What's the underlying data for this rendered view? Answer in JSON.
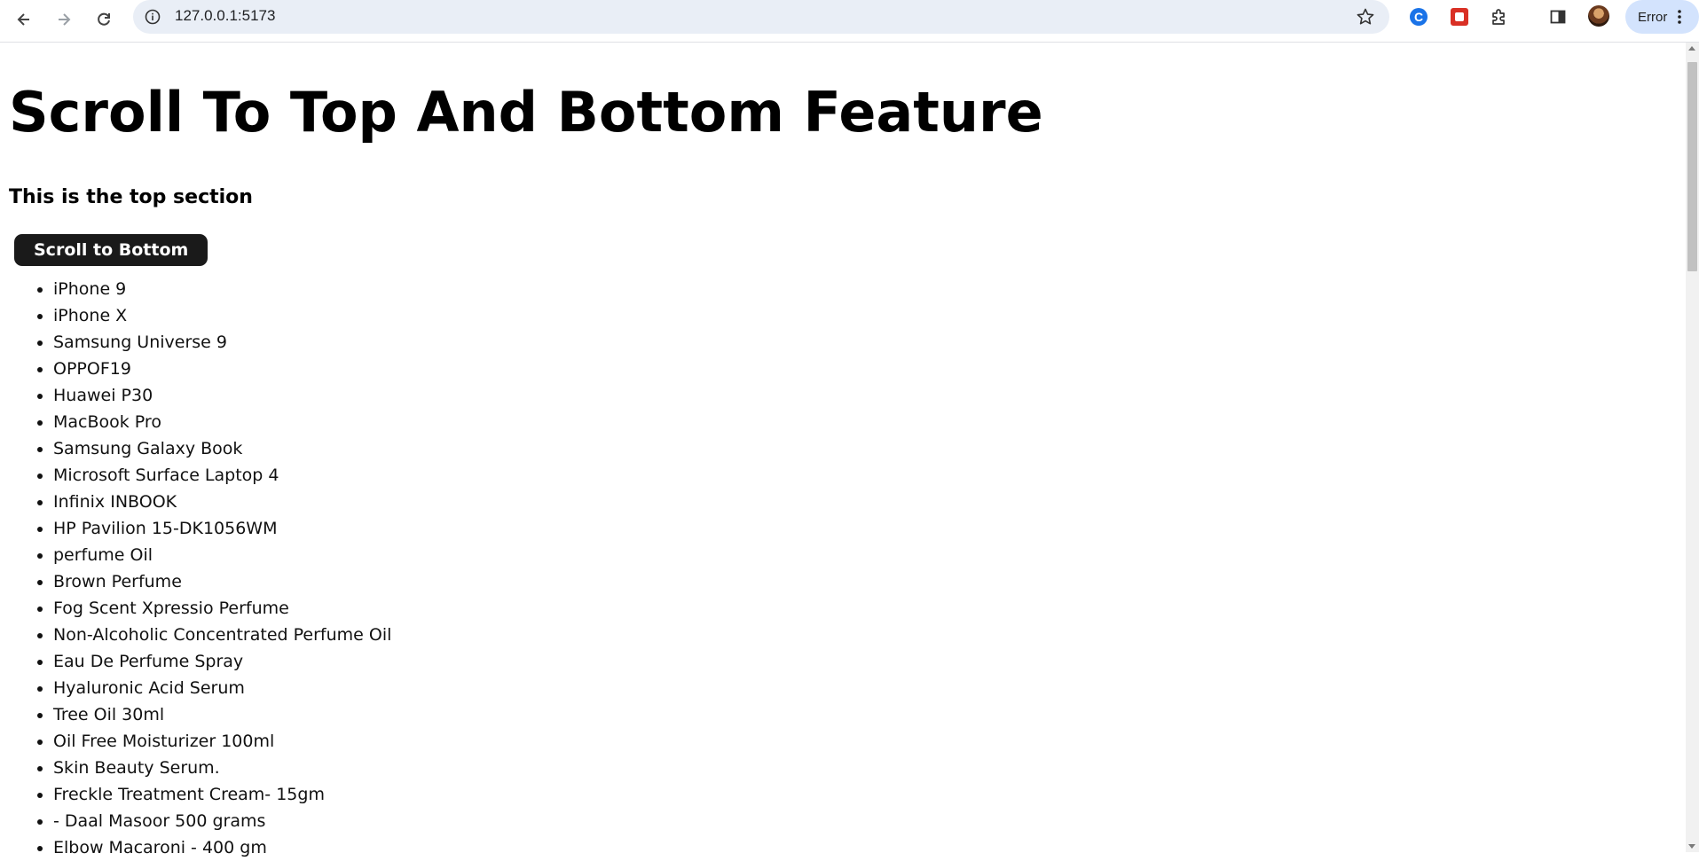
{
  "browser": {
    "url": "127.0.0.1:5173",
    "profile_status": "Error",
    "icons": [
      "back-icon",
      "forward-icon",
      "reload-icon",
      "site-info-icon",
      "bookmark-star-icon",
      "extension-c-icon",
      "extension-red-icon",
      "extensions-puzzle-icon",
      "side-panel-icon",
      "profile-avatar",
      "menu-kebab-icon"
    ]
  },
  "page": {
    "title": "Scroll To Top And Bottom Feature",
    "section_heading": "This is the top section",
    "scroll_button_label": "Scroll to Bottom",
    "products": [
      "iPhone 9",
      "iPhone X",
      "Samsung Universe 9",
      "OPPOF19",
      "Huawei P30",
      "MacBook Pro",
      "Samsung Galaxy Book",
      "Microsoft Surface Laptop 4",
      "Infinix INBOOK",
      "HP Pavilion 15-DK1056WM",
      "perfume Oil",
      "Brown Perfume",
      "Fog Scent Xpressio Perfume",
      "Non-Alcoholic Concentrated Perfume Oil",
      "Eau De Perfume Spray",
      "Hyaluronic Acid Serum",
      "Tree Oil 30ml",
      "Oil Free Moisturizer 100ml",
      "Skin Beauty Serum.",
      "Freckle Treatment Cream- 15gm",
      "- Daal Masoor 500 grams",
      "Elbow Macaroni - 400 gm"
    ]
  },
  "colors": {
    "omnibox_bg": "#e9eef6",
    "button_bg": "#1a1a1a",
    "error_pill_bg": "#d3e3fd"
  }
}
